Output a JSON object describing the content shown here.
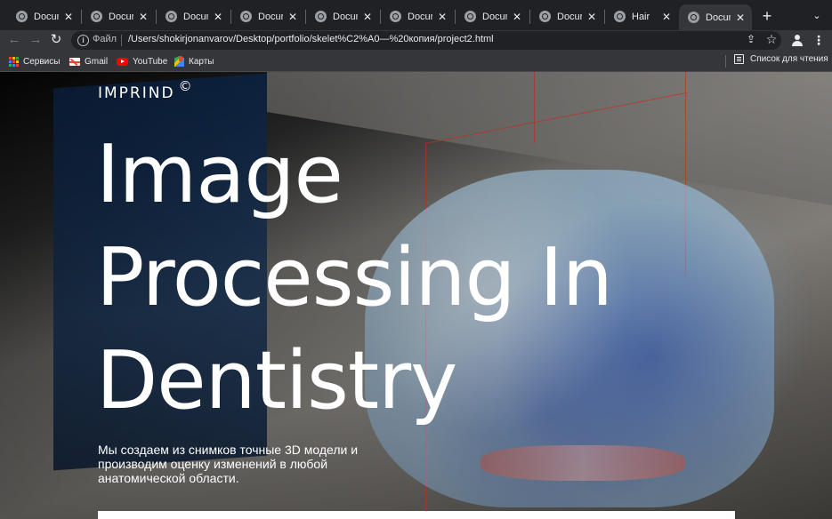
{
  "tabs": [
    {
      "title": "Document",
      "active": false
    },
    {
      "title": "Document",
      "active": false
    },
    {
      "title": "Document",
      "active": false
    },
    {
      "title": "Document",
      "active": false
    },
    {
      "title": "Document",
      "active": false
    },
    {
      "title": "Document",
      "active": false
    },
    {
      "title": "Document",
      "active": false
    },
    {
      "title": "Document",
      "active": false
    },
    {
      "title": "Hair",
      "active": false
    },
    {
      "title": "Document",
      "active": true
    }
  ],
  "toolbar": {
    "protocol_label": "Файл",
    "url": "/Users/shokirjonanvarov/Desktop/portfolio/skelet%C2%A0—%20копия/project2.html"
  },
  "bookmarks": {
    "items": [
      {
        "label": "Сервисы",
        "icon": "apps-grid-icon"
      },
      {
        "label": "Gmail",
        "icon": "gmail-icon"
      },
      {
        "label": "YouTube",
        "icon": "youtube-icon"
      },
      {
        "label": "Карты",
        "icon": "maps-icon"
      }
    ],
    "reading_list": "Список для чтения"
  },
  "page": {
    "brand": "IMPRIND",
    "brand_mark": "©",
    "title_lines": [
      "Image",
      "Processing In",
      "Dentistry"
    ],
    "subtitle": "Мы создаем из снимков точные 3D модели и производим оценку изменений в любой анатомической области."
  }
}
